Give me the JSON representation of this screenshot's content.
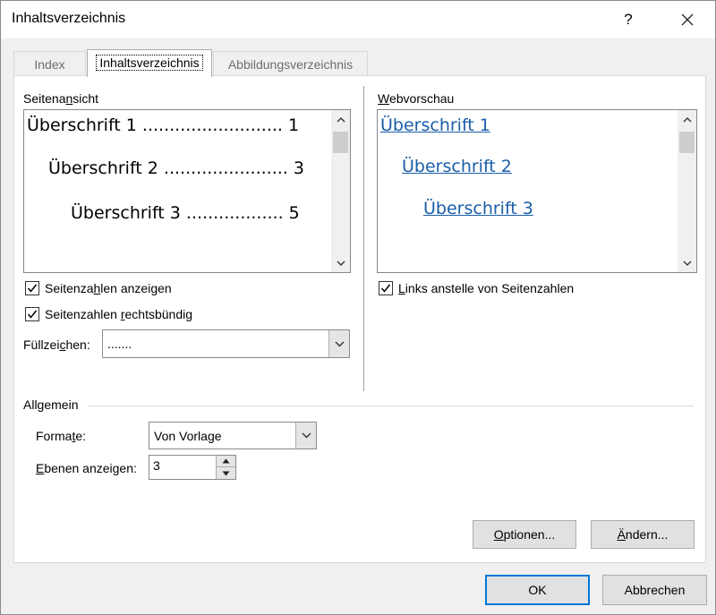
{
  "dialog": {
    "title": "Inhaltsverzeichnis",
    "help_label": "?"
  },
  "tabs": [
    {
      "label": "Index",
      "active": false
    },
    {
      "label": "Inhaltsverzeichnis",
      "active": true
    },
    {
      "label": "Abbildungsverzeichnis",
      "active": false
    }
  ],
  "page_view": {
    "label_pre": "Seitena",
    "label_ul": "n",
    "label_post": "sicht",
    "lines": [
      {
        "text": "Überschrift 1 .......................... 1"
      },
      {
        "text": "Überschrift 2 ....................... 3"
      },
      {
        "text": "Überschrift 3 .................. 5"
      }
    ]
  },
  "web_preview": {
    "label_ul": "W",
    "label_post": "ebvorschau",
    "links": [
      "Überschrift 1",
      "Überschrift 2",
      "Überschrift 3"
    ]
  },
  "options": {
    "show_page_numbers": {
      "pre": "Seitenza",
      "ul": "h",
      "post": "len anzeigen",
      "checked": true
    },
    "right_align": {
      "pre": "Seitenzahlen ",
      "ul": "r",
      "post": "echtsbündig",
      "checked": true
    },
    "fill_char_label": {
      "pre": "Füllzei",
      "ul": "c",
      "post": "hen:"
    },
    "fill_char_value": ".......",
    "links_instead": {
      "pre": "",
      "ul": "L",
      "post": "inks anstelle von Seitenzahlen",
      "checked": true
    }
  },
  "general": {
    "label": "Allgemein",
    "formats_label": {
      "pre": "Forma",
      "ul": "t",
      "post": "e:"
    },
    "formats_value": "Von Vorlage",
    "levels_label": {
      "pre": "",
      "ul": "E",
      "post": "benen anzeigen:"
    },
    "levels_value": "3"
  },
  "buttons": {
    "options": {
      "pre": "",
      "ul": "O",
      "post": "ptionen..."
    },
    "modify": {
      "pre": "",
      "ul": "Ä",
      "post": "ndern..."
    },
    "ok": "OK",
    "cancel": "Abbrechen"
  },
  "colors": {
    "link": "#1a5ea8",
    "accent": "#0078d7"
  }
}
